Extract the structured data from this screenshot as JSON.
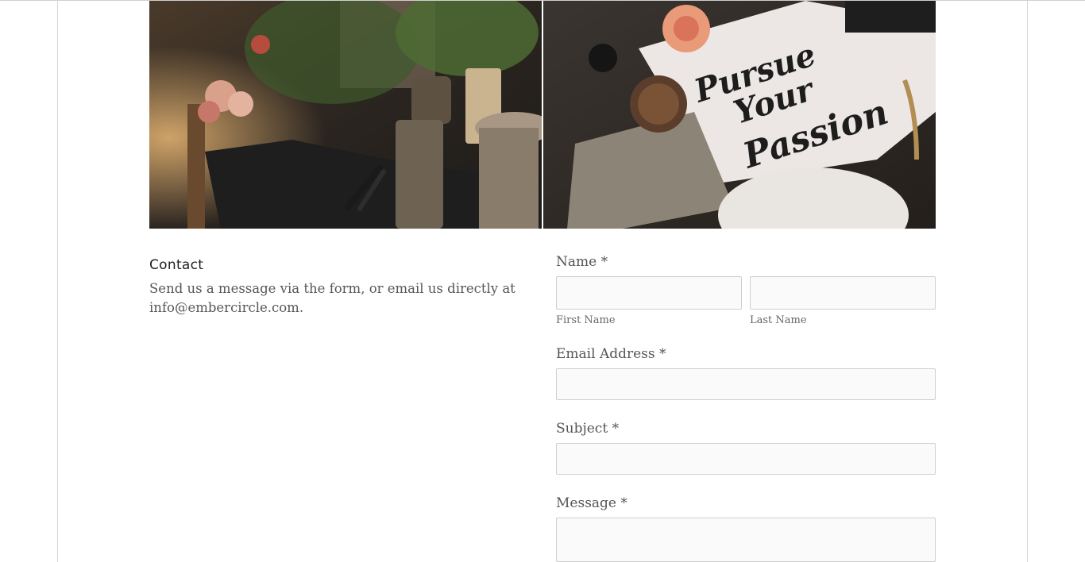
{
  "contact": {
    "heading": "Contact",
    "description": "Send us a message via the form, or email us directly at info@embercircle.com."
  },
  "form": {
    "name_label": "Name *",
    "first_name_label": "First Name",
    "last_name_label": "Last Name",
    "first_name_value": "",
    "last_name_value": "",
    "email_label": "Email Address *",
    "email_value": "",
    "subject_label": "Subject *",
    "subject_value": "",
    "message_label": "Message *",
    "message_value": ""
  },
  "images": {
    "left_alt": "flower shop counter with potted plants and pruning shears",
    "right_alt": "hand-lettered print with flowers and craft supplies",
    "right_lettering": [
      "Pursue",
      "Your",
      "Passion"
    ]
  }
}
